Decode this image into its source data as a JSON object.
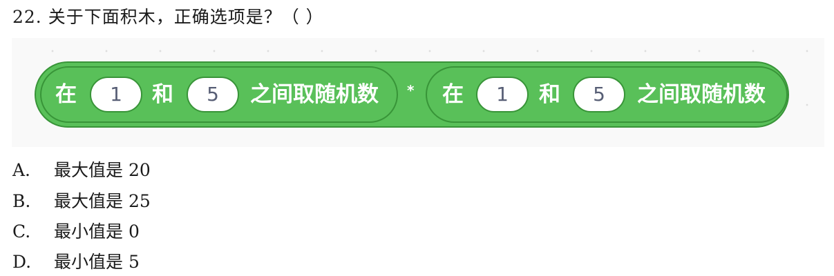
{
  "question": {
    "title": "22. 关于下面积木，正确选项是？（ ）"
  },
  "block": {
    "first": {
      "prefix": "在",
      "num1": "1",
      "and": "和",
      "num2": "5",
      "suffix": "之间取随机数"
    },
    "operator": "*",
    "second": {
      "prefix": "在",
      "num1": "1",
      "and": "和",
      "num2": "5",
      "suffix": "之间取随机数"
    },
    "colors": {
      "fill": "#59c059",
      "border": "#389438",
      "oval_text": "#575e75"
    }
  },
  "options": [
    {
      "letter": "A.",
      "text": "最大值是 20"
    },
    {
      "letter": "B.",
      "text": "最大值是 25"
    },
    {
      "letter": "C.",
      "text": "最小值是 0"
    },
    {
      "letter": "D.",
      "text": "最小值是 5"
    }
  ]
}
